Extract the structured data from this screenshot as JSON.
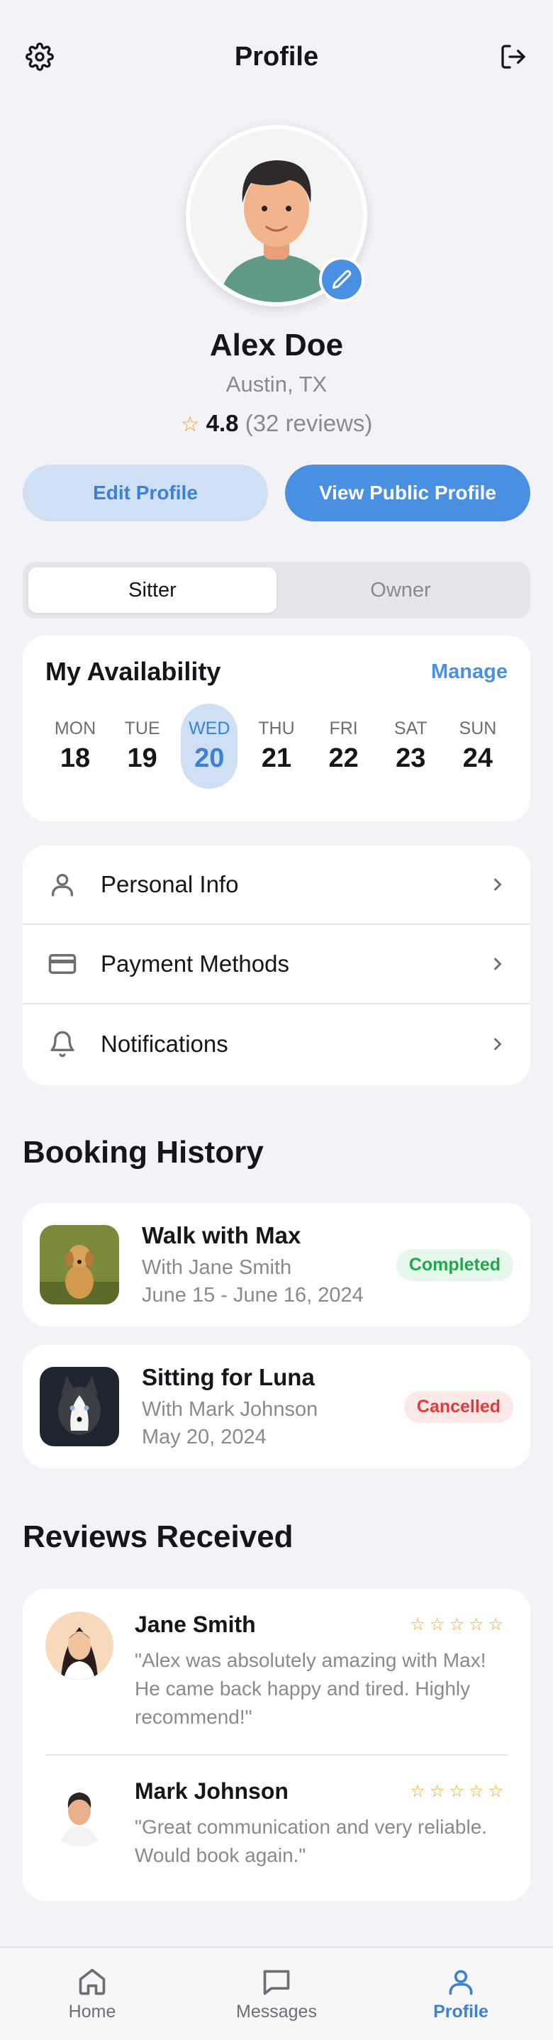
{
  "header": {
    "title": "Profile",
    "settings_icon": "gear-icon",
    "logout_icon": "logout-icon"
  },
  "profile": {
    "name": "Alex Doe",
    "location": "Austin, TX",
    "rating": "4.8",
    "reviews_count": "(32 reviews)"
  },
  "actions": {
    "edit_label": "Edit Profile",
    "public_label": "View Public Profile"
  },
  "segment": {
    "options": [
      "Sitter",
      "Owner"
    ],
    "selected": "Sitter"
  },
  "availability": {
    "title": "My Availability",
    "manage_label": "Manage",
    "days": [
      {
        "name": "MON",
        "date": "18"
      },
      {
        "name": "TUE",
        "date": "19"
      },
      {
        "name": "WED",
        "date": "20"
      },
      {
        "name": "THU",
        "date": "21"
      },
      {
        "name": "FRI",
        "date": "22"
      },
      {
        "name": "SAT",
        "date": "23"
      },
      {
        "name": "SUN",
        "date": "24"
      }
    ],
    "selected_day": "WED"
  },
  "menu": [
    {
      "label": "Personal Info",
      "icon": "person-icon"
    },
    {
      "label": "Payment Methods",
      "icon": "credit-card-icon"
    },
    {
      "label": "Notifications",
      "icon": "bell-icon"
    }
  ],
  "booking_history": {
    "title": "Booking History",
    "items": [
      {
        "title": "Walk with Max",
        "with": "With Jane Smith",
        "dates": "June 15 - June 16, 2024",
        "status": "Completed"
      },
      {
        "title": "Sitting for Luna",
        "with": "With Mark Johnson",
        "dates": "May 20, 2024",
        "status": "Cancelled"
      }
    ]
  },
  "reviews": {
    "title": "Reviews Received",
    "items": [
      {
        "name": "Jane Smith",
        "stars": "☆☆☆☆☆",
        "text": "\"Alex was absolutely amazing with Max! He came back happy and tired. Highly recommend!\""
      },
      {
        "name": "Mark Johnson",
        "stars": "☆☆☆☆☆",
        "text": "\"Great communication and very reliable. Would book again.\""
      }
    ]
  },
  "tabbar": {
    "items": [
      {
        "label": "Home",
        "icon": "home-icon"
      },
      {
        "label": "Messages",
        "icon": "chat-icon"
      },
      {
        "label": "Profile",
        "icon": "person-icon"
      }
    ],
    "active": "Profile"
  },
  "colors": {
    "accent": "#4a90e2",
    "background": "#f2f2f7",
    "success": "#22a64e",
    "danger": "#e23b3b",
    "star": "#f5a623"
  }
}
